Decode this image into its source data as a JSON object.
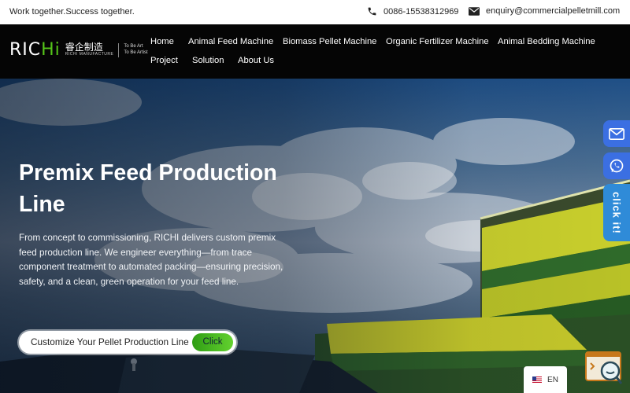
{
  "topbar": {
    "tagline": "Work together.Success together.",
    "phone": "0086-15538312969",
    "email": "enquiry@commercialpelletmill.com"
  },
  "logo": {
    "brand_prefix": "RIC",
    "brand_suffix": "Hi",
    "cn": "睿企制造",
    "sub": "RICHI MANUFACTURE",
    "slogan_line1": "To Be Art",
    "slogan_line2": "To Be Artist"
  },
  "nav": {
    "items": [
      {
        "label": "Home"
      },
      {
        "label": "Animal Feed Machine"
      },
      {
        "label": "Biomass Pellet Machine"
      },
      {
        "label": "Organic Fertilizer Machine"
      },
      {
        "label": "Animal Bedding Machine"
      },
      {
        "label": "Project"
      },
      {
        "label": "Solution"
      },
      {
        "label": "About Us"
      }
    ]
  },
  "hero": {
    "title": "Premix Feed Production Line",
    "description": "From concept to commissioning, RICHI delivers custom premix feed production line. We engineer everything—from trace component treatment to automated packing—ensuring precision, safety, and a clean, green operation for your feed line.",
    "cta_label": "Customize Your Pellet Production Line",
    "cta_click": "Click"
  },
  "side": {
    "click_label": "click it!"
  },
  "language": {
    "code": "EN"
  },
  "icons": {
    "phone": "phone-icon",
    "mail": "mail-icon",
    "whatsapp": "whatsapp-icon",
    "chat": "chat-widget-icon"
  },
  "colors": {
    "accent_green": "#55c51a",
    "side_blue": "#3b6fe2",
    "header_bg": "#050505"
  }
}
